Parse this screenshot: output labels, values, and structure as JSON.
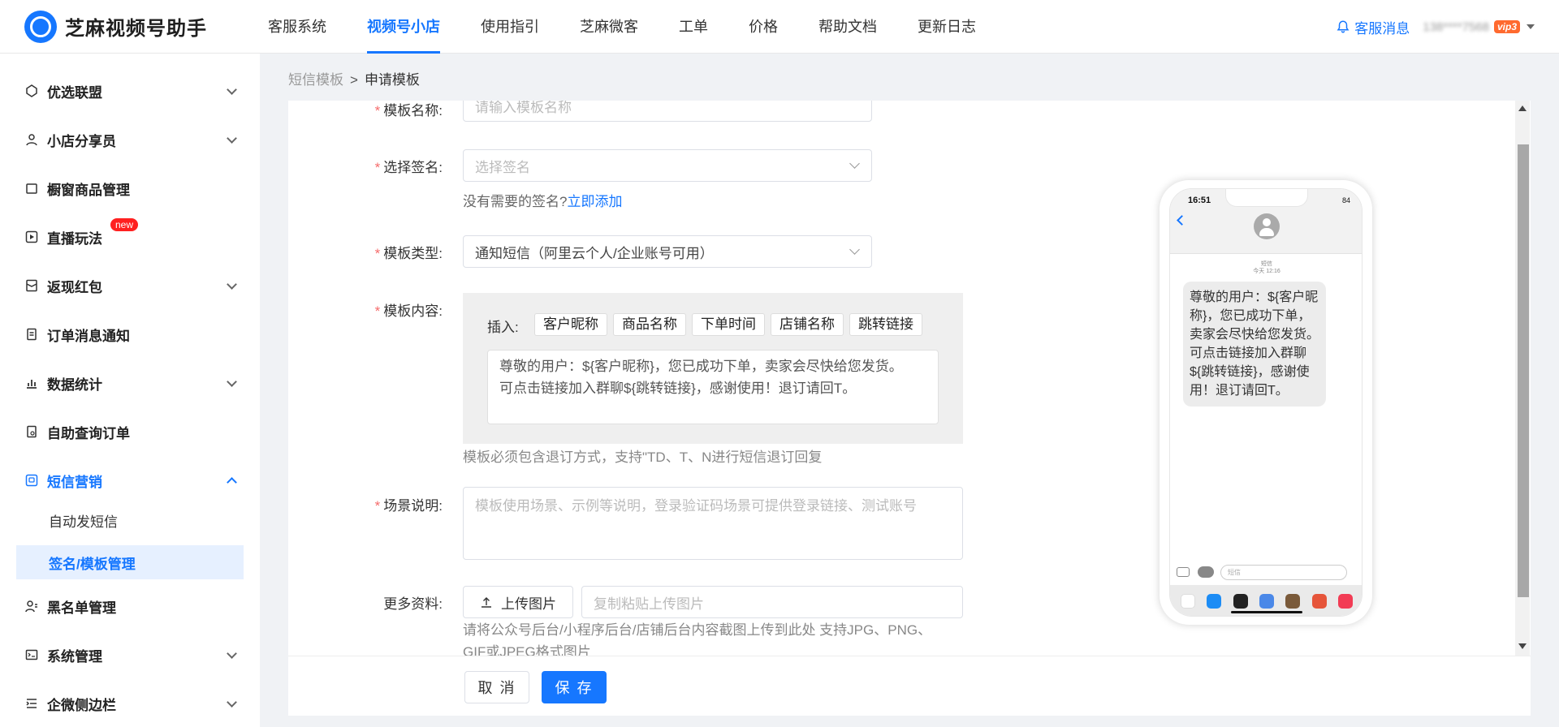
{
  "app": {
    "name": "芝麻视频号助手"
  },
  "nav": {
    "items": [
      "客服系统",
      "视频号小店",
      "使用指引",
      "芝麻微客",
      "工单",
      "价格",
      "帮助文档",
      "更新日志"
    ],
    "active": "视频号小店"
  },
  "header": {
    "messages_label": "客服消息",
    "user": "138****7568",
    "vip_badge": "vip3"
  },
  "sidebar": {
    "items": [
      {
        "label": "优选联盟",
        "expandable": true,
        "icon": "diamond-icon"
      },
      {
        "label": "小店分享员",
        "expandable": true,
        "icon": "share-icon"
      },
      {
        "label": "橱窗商品管理",
        "expandable": false,
        "icon": "goods-icon"
      },
      {
        "label": "直播玩法",
        "expandable": false,
        "icon": "live-icon",
        "badge": "new"
      },
      {
        "label": "返现红包",
        "expandable": true,
        "icon": "redpacket-icon"
      },
      {
        "label": "订单消息通知",
        "expandable": false,
        "icon": "order-notice-icon"
      },
      {
        "label": "数据统计",
        "expandable": true,
        "icon": "chart-icon"
      },
      {
        "label": "自助查询订单",
        "expandable": false,
        "icon": "query-icon"
      },
      {
        "label": "短信营销",
        "expandable": true,
        "expanded": true,
        "icon": "sms-icon"
      },
      {
        "label": "黑名单管理",
        "expandable": false,
        "icon": "blacklist-icon"
      },
      {
        "label": "系统管理",
        "expandable": true,
        "icon": "system-icon"
      },
      {
        "label": "企微侧边栏",
        "expandable": true,
        "icon": "sidebar-icon"
      }
    ],
    "sub_items": [
      "自动发短信",
      "签名/模板管理"
    ],
    "selected_sub": "签名/模板管理"
  },
  "breadcrumb": {
    "parent": "短信模板",
    "separator": ">",
    "current": "申请模板"
  },
  "form": {
    "name": {
      "label": "模板名称:",
      "placeholder": "请输入模板名称"
    },
    "signature": {
      "label": "选择签名:",
      "placeholder": "选择签名",
      "hint": "没有需要的签名?",
      "hint_link": "立即添加"
    },
    "type": {
      "label": "模板类型:",
      "value": "通知短信（阿里云个人/企业账号可用）"
    },
    "content": {
      "label": "模板内容:",
      "insert_label": "插入:",
      "tags": [
        "客户昵称",
        "商品名称",
        "下单时间",
        "店铺名称",
        "跳转链接"
      ],
      "value_line1": "尊敬的用户：${客户昵称}，您已成功下单，卖家会尽快给您发货。",
      "value_line2": "可点击链接加入群聊${跳转链接}，感谢使用！退订请回T。",
      "hint": "模板必须包含退订方式，支持\"TD、T、N进行短信退订回复"
    },
    "scene": {
      "label": "场景说明:",
      "placeholder": "模板使用场景、示例等说明，登录验证码场景可提供登录链接、测试账号"
    },
    "more": {
      "label": "更多资料:",
      "upload_label": "上传图片",
      "paste_placeholder": "复制粘贴上传图片",
      "hint_line1": "请将公众号后台/小程序后台/店铺后台内容截图上传到此处 支持JPG、PNG、",
      "hint_line2": "GIF或JPEG格式图片"
    }
  },
  "footer": {
    "cancel": "取 消",
    "save": "保 存"
  },
  "phone": {
    "time": "16:51",
    "status": "84",
    "meta_line1": "短信",
    "meta_line2": "今天 12:16",
    "message": "尊敬的用户：${客户昵称}，您已成功下单，卖家会尽快给您发货。可点击链接加入群聊${跳转链接}，感谢使用！退订请回T。",
    "input_placeholder": "短信"
  },
  "colors": {
    "accent": "#1677ff",
    "required": "#f56c6c",
    "badge": "#ff2020"
  }
}
